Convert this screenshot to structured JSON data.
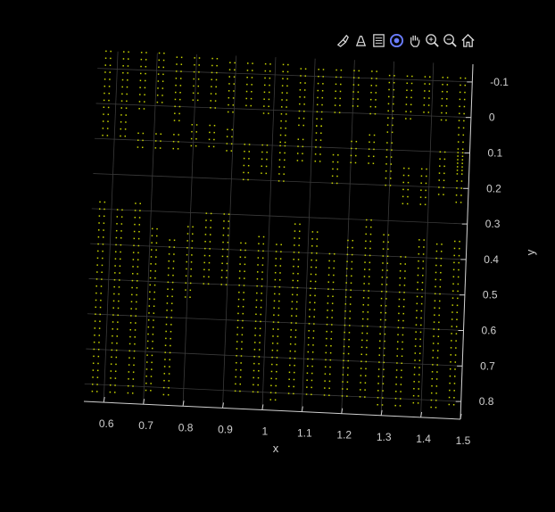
{
  "toolbar": {
    "buttons": [
      {
        "name": "brush-icon"
      },
      {
        "name": "data-tips-icon"
      },
      {
        "name": "legend-icon"
      },
      {
        "name": "rotate-3d-icon"
      },
      {
        "name": "pan-hand-icon"
      },
      {
        "name": "zoom-in-icon"
      },
      {
        "name": "zoom-out-icon"
      },
      {
        "name": "home-icon"
      }
    ]
  },
  "chart_data": {
    "type": "scatter",
    "title": "",
    "xlabel": "x",
    "ylabel": "y",
    "xlim": [
      0.55,
      1.5
    ],
    "ylim": [
      -0.15,
      0.85
    ],
    "y_direction": "reversed",
    "x_ticks": [
      "0.6",
      "0.7",
      "0.8",
      "0.9",
      "1",
      "1.1",
      "1.2",
      "1.3",
      "1.4",
      "1.5"
    ],
    "x_tick_values": [
      0.6,
      0.7,
      0.8,
      0.9,
      1.0,
      1.1,
      1.2,
      1.3,
      1.4,
      1.5
    ],
    "y_ticks": [
      "-0.1",
      "0",
      "0.1",
      "0.2",
      "0.3",
      "0.4",
      "0.5",
      "0.6",
      "0.7",
      "0.8"
    ],
    "y_tick_values": [
      -0.1,
      0,
      0.1,
      0.2,
      0.3,
      0.4,
      0.5,
      0.6,
      0.7,
      0.8
    ],
    "grid": true,
    "background": "#000000",
    "grid_color": "#3a3a3a",
    "axis_color": "#d0d0d0",
    "marker_color": "#c8d400",
    "column_x": [
      0.57,
      0.615,
      0.66,
      0.705,
      0.75,
      0.795,
      0.84,
      0.885,
      0.93,
      0.975,
      1.02,
      1.065,
      1.11,
      1.155,
      1.2,
      1.245,
      1.29,
      1.335,
      1.38,
      1.425,
      1.47
    ],
    "segments": [
      {
        "col": 0,
        "y0": -0.15,
        "y1": 0.1
      },
      {
        "col": 1,
        "y0": -0.15,
        "y1": 0.1
      },
      {
        "col": 2,
        "y0": -0.15,
        "y1": 0.02
      },
      {
        "col": 3,
        "y0": -0.15,
        "y1": 0.0
      },
      {
        "col": 4,
        "y0": -0.14,
        "y1": 0.05
      },
      {
        "col": 5,
        "y0": -0.14,
        "y1": -0.02
      },
      {
        "col": 6,
        "y0": -0.14,
        "y1": 0.0
      },
      {
        "col": 7,
        "y0": -0.13,
        "y1": 0.02
      },
      {
        "col": 8,
        "y0": -0.13,
        "y1": 0.0
      },
      {
        "col": 9,
        "y0": -0.13,
        "y1": 0.02
      },
      {
        "col": 10,
        "y0": -0.13,
        "y1": 0.1
      },
      {
        "col": 11,
        "y0": -0.12,
        "y1": 0.05
      },
      {
        "col": 12,
        "y0": -0.12,
        "y1": 0.05
      },
      {
        "col": 13,
        "y0": -0.12,
        "y1": 0.0
      },
      {
        "col": 14,
        "y0": -0.12,
        "y1": -0.02
      },
      {
        "col": 15,
        "y0": -0.12,
        "y1": 0.0
      },
      {
        "col": 16,
        "y0": -0.11,
        "y1": 0.05
      },
      {
        "col": 17,
        "y0": -0.11,
        "y1": 0.02
      },
      {
        "col": 18,
        "y0": -0.11,
        "y1": 0.0
      },
      {
        "col": 19,
        "y0": -0.11,
        "y1": 0.02
      },
      {
        "col": 20,
        "y0": -0.11,
        "y1": 0.15
      },
      {
        "col": 2,
        "y0": 0.08,
        "y1": 0.12
      },
      {
        "col": 3,
        "y0": 0.08,
        "y1": 0.12
      },
      {
        "col": 4,
        "y0": 0.08,
        "y1": 0.12
      },
      {
        "col": 5,
        "y0": 0.05,
        "y1": 0.12
      },
      {
        "col": 6,
        "y0": 0.05,
        "y1": 0.12
      },
      {
        "col": 7,
        "y0": 0.06,
        "y1": 0.12
      },
      {
        "col": 8,
        "y0": 0.1,
        "y1": 0.2
      },
      {
        "col": 9,
        "y0": 0.1,
        "y1": 0.18
      },
      {
        "col": 10,
        "y0": 0.1,
        "y1": 0.2
      },
      {
        "col": 11,
        "y0": 0.08,
        "y1": 0.15
      },
      {
        "col": 12,
        "y0": 0.04,
        "y1": 0.15
      },
      {
        "col": 13,
        "y0": 0.12,
        "y1": 0.2
      },
      {
        "col": 14,
        "y0": 0.08,
        "y1": 0.15
      },
      {
        "col": 15,
        "y0": 0.06,
        "y1": 0.15
      },
      {
        "col": 16,
        "y0": 0.08,
        "y1": 0.2
      },
      {
        "col": 17,
        "y0": 0.15,
        "y1": 0.25
      },
      {
        "col": 18,
        "y0": 0.15,
        "y1": 0.25
      },
      {
        "col": 19,
        "y0": 0.1,
        "y1": 0.22
      },
      {
        "col": 20,
        "y0": 0.1,
        "y1": 0.25
      },
      {
        "col": 0,
        "y0": 0.28,
        "y1": 0.82
      },
      {
        "col": 1,
        "y0": 0.3,
        "y1": 0.82
      },
      {
        "col": 2,
        "y0": 0.28,
        "y1": 0.82
      },
      {
        "col": 3,
        "y0": 0.35,
        "y1": 0.82
      },
      {
        "col": 4,
        "y0": 0.38,
        "y1": 0.82
      },
      {
        "col": 5,
        "y0": 0.34,
        "y1": 0.55
      },
      {
        "col": 6,
        "y0": 0.3,
        "y1": 0.5
      },
      {
        "col": 7,
        "y0": 0.3,
        "y1": 0.5
      },
      {
        "col": 8,
        "y0": 0.38,
        "y1": 0.8
      },
      {
        "col": 9,
        "y0": 0.36,
        "y1": 0.8
      },
      {
        "col": 10,
        "y0": 0.38,
        "y1": 0.82
      },
      {
        "col": 11,
        "y0": 0.32,
        "y1": 0.8
      },
      {
        "col": 12,
        "y0": 0.34,
        "y1": 0.8
      },
      {
        "col": 13,
        "y0": 0.4,
        "y1": 0.8
      },
      {
        "col": 14,
        "y0": 0.36,
        "y1": 0.8
      },
      {
        "col": 15,
        "y0": 0.3,
        "y1": 0.8
      },
      {
        "col": 16,
        "y0": 0.34,
        "y1": 0.82
      },
      {
        "col": 17,
        "y0": 0.4,
        "y1": 0.82
      },
      {
        "col": 18,
        "y0": 0.35,
        "y1": 0.82
      },
      {
        "col": 19,
        "y0": 0.36,
        "y1": 0.82
      },
      {
        "col": 20,
        "y0": 0.35,
        "y1": 0.82
      }
    ],
    "point_spacing_y": 0.02
  }
}
